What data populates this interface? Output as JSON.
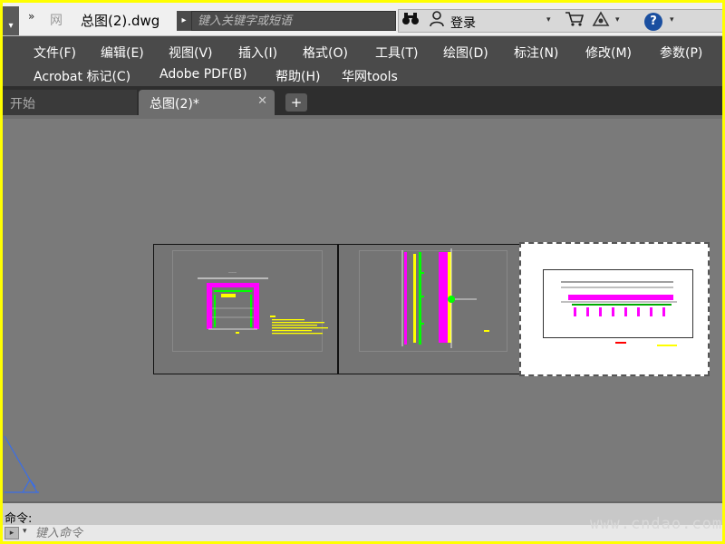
{
  "titlebar": {
    "qa_arrow": "▾",
    "qa_more": "»",
    "app_logo": "网",
    "doc_title": "总图(2).dwg",
    "search_arrow": "▸",
    "search_placeholder": "键入关键字或短语",
    "login": "登录",
    "drop": "▾",
    "help": "?"
  },
  "icons": {
    "binoculars": "binoculars-icon",
    "user": "user-icon",
    "cart": "cart-icon",
    "exchange": "exchange-icon",
    "help": "help-icon",
    "close": "close-icon",
    "add": "add-tab-icon"
  },
  "menu": {
    "row1": [
      "文件(F)",
      "编辑(E)",
      "视图(V)",
      "插入(I)",
      "格式(O)",
      "工具(T)",
      "绘图(D)",
      "标注(N)",
      "修改(M)",
      "参数(P)"
    ],
    "row2": [
      "Acrobat 标记(C)",
      "Adobe PDF(B)",
      "帮助(H)",
      "华网tools"
    ]
  },
  "tabs": {
    "start": "开始",
    "active": "总图(2)*",
    "close": "✕",
    "add": "+"
  },
  "command": {
    "label": "命令:",
    "placeholder": "键入命令",
    "btn": "▸",
    "drop": "▾"
  },
  "watermark": "www.cndao.com",
  "colors": {
    "frame_border": "#ffff00",
    "menubar": "#4a4a4a",
    "canvas": "#7a7a7a",
    "cad_magenta": "#ff00ff",
    "cad_yellow": "#ffff00",
    "cad_green": "#00ff00",
    "ucs_blue": "#3a6ee8"
  }
}
